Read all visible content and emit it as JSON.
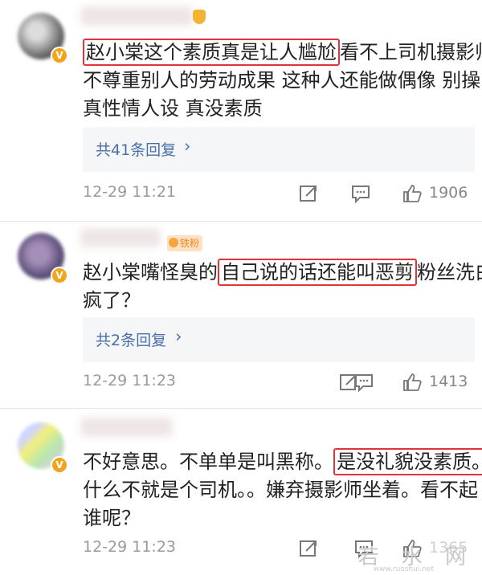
{
  "comments": [
    {
      "text_pre": "赵小棠这个素质真是让人尴尬",
      "text_line1_rest": "看不上司机摄影师",
      "text_line2": "不尊重别人的劳动成果 这种人还能做偶像 别操",
      "text_line3": "真性情人设 真没素质",
      "replies_label": "共41条回复",
      "time": "12-29 11:21",
      "likes": "1906"
    },
    {
      "fan_badge": "铁粉",
      "text_pre": "赵小棠嘴怪臭的",
      "text_highlight": "自己说的话还能叫恶剪",
      "text_line1_rest": "粉丝洗白",
      "text_line2": "疯了？",
      "replies_label": "共2条回复",
      "time": "12-29 11:23",
      "likes": "1413"
    },
    {
      "text_pre": "不好意思。不单单是叫黑称。",
      "text_highlight": "是没礼貌没素质。",
      "text_line2": "什么不就是个司机。。嫌弃摄影师坐着。看不起",
      "text_line3": "谁呢？",
      "time": "12-29 11:23",
      "likes": "1365"
    }
  ],
  "icons": {
    "repost": "share-icon",
    "comment": "comment-icon",
    "like": "thumbs-up-icon",
    "chevron": "chevron-right-icon"
  },
  "watermark": "若 水 网",
  "watermark_small": "www.ruoshui.net",
  "colors": {
    "highlight_border": "#e0343a",
    "link_blue": "#4a6fa8",
    "verified_orange": "#f2a51c"
  }
}
